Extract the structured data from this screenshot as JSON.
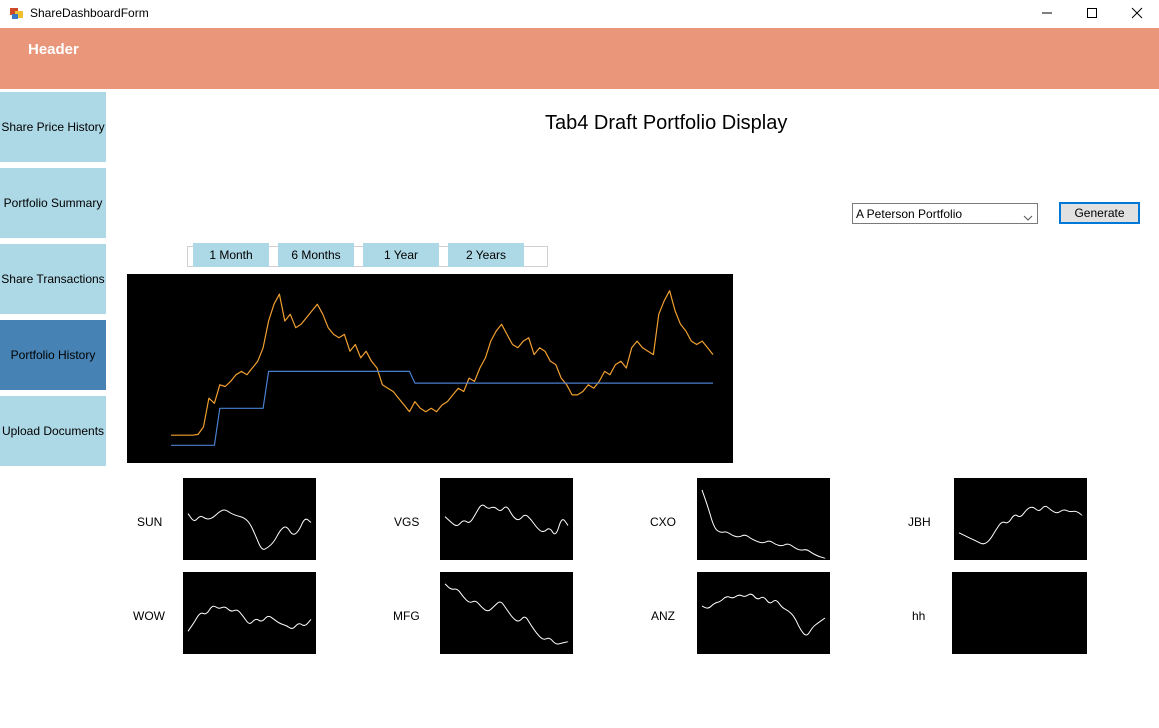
{
  "window": {
    "title": "ShareDashboardForm",
    "icon": "winforms-app-icon",
    "controls": [
      "minimize-icon",
      "maximize-icon",
      "close-icon"
    ]
  },
  "header": {
    "label": "Header",
    "color": "#e9967a"
  },
  "sidebar": {
    "items": [
      {
        "label": "Share Price History",
        "active": false
      },
      {
        "label": "Portfolio Summary",
        "active": false
      },
      {
        "label": "Share Transactions",
        "active": false
      },
      {
        "label": "Portfolio History",
        "active": true
      },
      {
        "label": "Upload Documents",
        "active": false
      }
    ],
    "color": "#add8e6",
    "active_color": "#4682b4"
  },
  "main": {
    "title": "Tab4 Draft Portfolio Display",
    "portfolio_select": {
      "value": "A Peterson Portfolio"
    },
    "generate_label": "Generate",
    "ranges": [
      "1 Month",
      "6 Months",
      "1 Year",
      "2 Years"
    ]
  },
  "chart_data": [
    {
      "type": "line",
      "series": [
        {
          "color": "#f0a030",
          "values": [
            0,
            0,
            0,
            0,
            0,
            0.5,
            5,
            22,
            19,
            30,
            29,
            32,
            36,
            38,
            36,
            40,
            44,
            52,
            68,
            78,
            84,
            68,
            72,
            64,
            66,
            70,
            74,
            78,
            72,
            64,
            60,
            58,
            60,
            50,
            54,
            46,
            50,
            44,
            40,
            30,
            28,
            26,
            22,
            18,
            14,
            20,
            16,
            14,
            16,
            14,
            18,
            20,
            24,
            28,
            26,
            34,
            32,
            40,
            46,
            56,
            62,
            66,
            60,
            54,
            52,
            56,
            58,
            48,
            52,
            50,
            44,
            42,
            34,
            30,
            24,
            24,
            26,
            30,
            28,
            32,
            38,
            36,
            42,
            44,
            40,
            52,
            56,
            52,
            50,
            48,
            72,
            80,
            86,
            74,
            66,
            62,
            56,
            54,
            56,
            52,
            48
          ]
        },
        {
          "color": "#4a7fd0",
          "values": [
            -6,
            -6,
            -6,
            -6,
            -6,
            -6,
            -6,
            -6,
            -6,
            16,
            16,
            16,
            16,
            16,
            16,
            16,
            16,
            16,
            38,
            38,
            38,
            38,
            38,
            38,
            38,
            38,
            38,
            38,
            38,
            38,
            38,
            38,
            38,
            38,
            38,
            38,
            38,
            38,
            38,
            38,
            38,
            38,
            38,
            38,
            38,
            31,
            31,
            31,
            31,
            31,
            31,
            31,
            31,
            31,
            31,
            31,
            31,
            31,
            31,
            31,
            31,
            31,
            31,
            31,
            31,
            31,
            31,
            31,
            31,
            31,
            31,
            31,
            31,
            31,
            31,
            31,
            31,
            31,
            31,
            31,
            31,
            31,
            31,
            31,
            31,
            31,
            31,
            31,
            31,
            31,
            31,
            31,
            31,
            31,
            31,
            31,
            31,
            31,
            31,
            31,
            31
          ]
        }
      ]
    },
    {
      "type": "line",
      "label": "SUN",
      "values": [
        60,
        48,
        58,
        52,
        54,
        62,
        66,
        60,
        57,
        55,
        48,
        30,
        10,
        14,
        22,
        38,
        44,
        30,
        36,
        55,
        48
      ]
    },
    {
      "type": "line",
      "label": "VGS",
      "values": [
        56,
        48,
        42,
        52,
        46,
        60,
        74,
        66,
        70,
        62,
        72,
        56,
        50,
        60,
        52,
        40,
        34,
        42,
        28,
        56,
        44
      ]
    },
    {
      "type": "line",
      "label": "CXO",
      "values": [
        92,
        68,
        40,
        34,
        36,
        30,
        28,
        32,
        26,
        22,
        20,
        24,
        18,
        16,
        20,
        14,
        10,
        12,
        6,
        2,
        0
      ]
    },
    {
      "type": "line",
      "label": "JBH",
      "values": [
        34,
        30,
        26,
        22,
        18,
        24,
        38,
        50,
        46,
        60,
        54,
        66,
        70,
        62,
        72,
        64,
        60,
        66,
        62,
        64,
        58
      ]
    },
    {
      "type": "line",
      "label": "WOW",
      "values": [
        28,
        40,
        54,
        50,
        64,
        58,
        62,
        54,
        58,
        48,
        36,
        46,
        40,
        50,
        44,
        38,
        36,
        30,
        40,
        34,
        44
      ]
    },
    {
      "type": "line",
      "label": "MFG",
      "values": [
        92,
        84,
        86,
        74,
        66,
        70,
        60,
        54,
        62,
        70,
        58,
        46,
        40,
        50,
        36,
        24,
        16,
        20,
        10,
        12,
        14
      ]
    },
    {
      "type": "line",
      "label": "ANZ",
      "values": [
        62,
        58,
        66,
        68,
        76,
        72,
        78,
        74,
        80,
        70,
        76,
        64,
        72,
        60,
        56,
        48,
        30,
        20,
        34,
        40,
        46
      ]
    },
    {
      "type": "line",
      "label": "hh",
      "values": []
    }
  ]
}
